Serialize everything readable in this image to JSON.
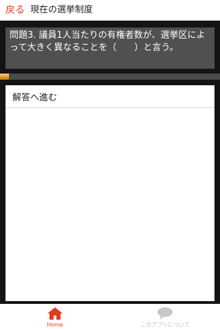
{
  "header": {
    "back_label": "戻る",
    "title": "現在の選挙制度"
  },
  "question": {
    "text": "問題3. 議員1人当たりの有権者数が、選挙区によって大きく異なることを（　　）と言う。"
  },
  "progress": {
    "value": 0.04
  },
  "answer": {
    "label": "解答へ進む"
  },
  "tabbar": {
    "home_label": "Home",
    "about_label": "このアプリについて",
    "home_icon": "home-icon",
    "about_icon": "speech-bubble-icon"
  },
  "colors": {
    "accent": "#e23b1c",
    "progress": "#e6a228",
    "question_bg": "#505050",
    "frame": "#141414",
    "inactive": "#c2c2c2"
  }
}
